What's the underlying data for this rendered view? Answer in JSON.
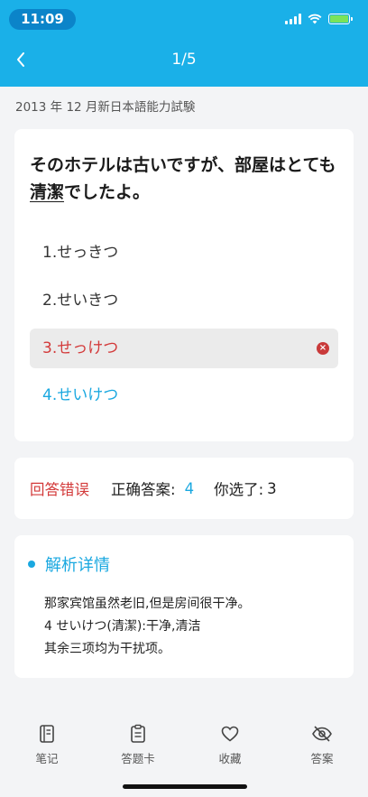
{
  "status_bar": {
    "time": "11:09"
  },
  "header": {
    "counter": "1/5"
  },
  "exam_title": "2013 年 12 月新日本語能力試験",
  "question": {
    "text_before": "そのホテルは古いですが、部屋はとても",
    "underlined": "清潔",
    "text_after": "でしたよ。",
    "options": [
      {
        "label": "1.せっきつ",
        "state": "normal"
      },
      {
        "label": "2.せいきつ",
        "state": "normal"
      },
      {
        "label": "3.せっけつ",
        "state": "wrong"
      },
      {
        "label": "4.せいけつ",
        "state": "correct"
      }
    ]
  },
  "result": {
    "status": "回答错误",
    "correct_label": "正确答案:",
    "correct_value": "4",
    "chosen_label": "你选了:",
    "chosen_value": "3"
  },
  "analysis": {
    "title": "解析详情",
    "lines": [
      "那家宾馆虽然老旧,但是房间很干净。",
      "4 せいけつ(清潔):干净,清洁",
      "其余三项均为干扰项。"
    ]
  },
  "tabbar": {
    "tabs": [
      {
        "label": "笔记",
        "icon": "notebook-icon"
      },
      {
        "label": "答题卡",
        "icon": "clipboard-icon"
      },
      {
        "label": "收藏",
        "icon": "heart-icon"
      },
      {
        "label": "答案",
        "icon": "eye-off-icon"
      }
    ]
  },
  "colors": {
    "header": "#1ab0e8",
    "accent": "#1aa8e0",
    "error": "#d33a3a"
  }
}
